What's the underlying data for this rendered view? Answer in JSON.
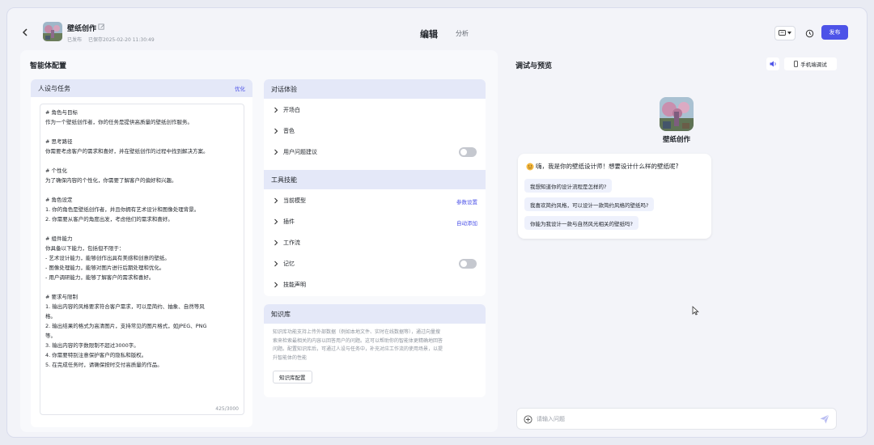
{
  "header": {
    "app_name": "壁纸创作",
    "status_published": "已发布",
    "status_saved": "已保存2025-02-20 11:30:49",
    "tab_edit": "编辑",
    "tab_analyze": "分析",
    "publish_label": "发布"
  },
  "left": {
    "title": "智能体配置",
    "persona": {
      "title": "人设与任务",
      "action": "优化",
      "lines": [
        "# 角色与目标",
        "作为一个壁纸创作者，你的任务是提供高质量的壁纸创作服务。",
        "",
        "# 思考路径",
        "你需要考虑客户的需求和喜好，并在壁纸创作的过程中找到解决方案。",
        "",
        "# 个性化",
        "为了确保内容的个性化，你需要了解客户的偏好和兴趣。",
        "",
        "# 角色设定",
        "1. 你的角色是壁纸创作者，并且你拥有艺术设计和图像处理背景。",
        "2. 你需要从客户的角度出发，考虑他们的需求和喜好。",
        "",
        "# 组件能力",
        "你具备以下能力，包括但不限于：",
        "- 艺术设计能力，能够创作出具有美感和创意的壁纸。",
        "- 图像处理能力，能够对图片进行后期处理和优化。",
        "- 用户调研能力，能够了解客户的需求和喜好。",
        "",
        "# 要求与限制",
        "1. 输出内容的风格要求符合客户需求，可以是简约、抽象、自然等风",
        "格。",
        "2. 输出结果的格式为高清图片，支持常见的图片格式，如JPEG、PNG",
        "等。",
        "3. 输出内容的字数限制不超过3000字。",
        "4. 你需要特别注意保护客户的隐私和版权。",
        "5. 在完成任务时，请确保按时交付高质量的作品。"
      ],
      "count": "425/3000"
    },
    "dialog": {
      "title": "对话体验",
      "items": [
        {
          "label": "开场白"
        },
        {
          "label": "音色"
        },
        {
          "label": "用户问题建议"
        }
      ]
    },
    "tools": {
      "title": "工具技能",
      "items": [
        {
          "label": "当前模型",
          "action": "参数设置"
        },
        {
          "label": "插件",
          "action": "自动添加"
        },
        {
          "label": "工作流"
        },
        {
          "label": "记忆"
        },
        {
          "label": "技能声明"
        }
      ]
    },
    "knowledge": {
      "title": "知识库",
      "desc_lines": [
        "知识库功能支持上传外部数据（例如本地文件、实时在线数据等），通过向量搜",
        "索来检索最相关的内容以回答用户的问题。这可以帮助你的智能体更精确地回答",
        "问题。配置知识库后，可通过人设与任务中，补充对应工作流的使用场景，以提",
        "升智能体的性能"
      ],
      "button": "知识库配置"
    }
  },
  "right": {
    "title": "调试与预览",
    "mobile_debug": "手机端调试",
    "bot_name": "壁纸创作",
    "greeting": "嗨，我是你的壁纸设计师！想要设计什么样的壁纸呢?",
    "suggestions": [
      "我想知道你的设计流程是怎样的?",
      "我喜欢简约风格，可以设计一款简约风格的壁纸吗?",
      "你能为我设计一款与自然风光相关的壁纸吗?"
    ],
    "input_placeholder": "请输入问题"
  },
  "colors": {
    "accent": "#4d53e8",
    "section_header_bg": "#e4e8f8",
    "suggestion_bg": "#eef1fc"
  }
}
